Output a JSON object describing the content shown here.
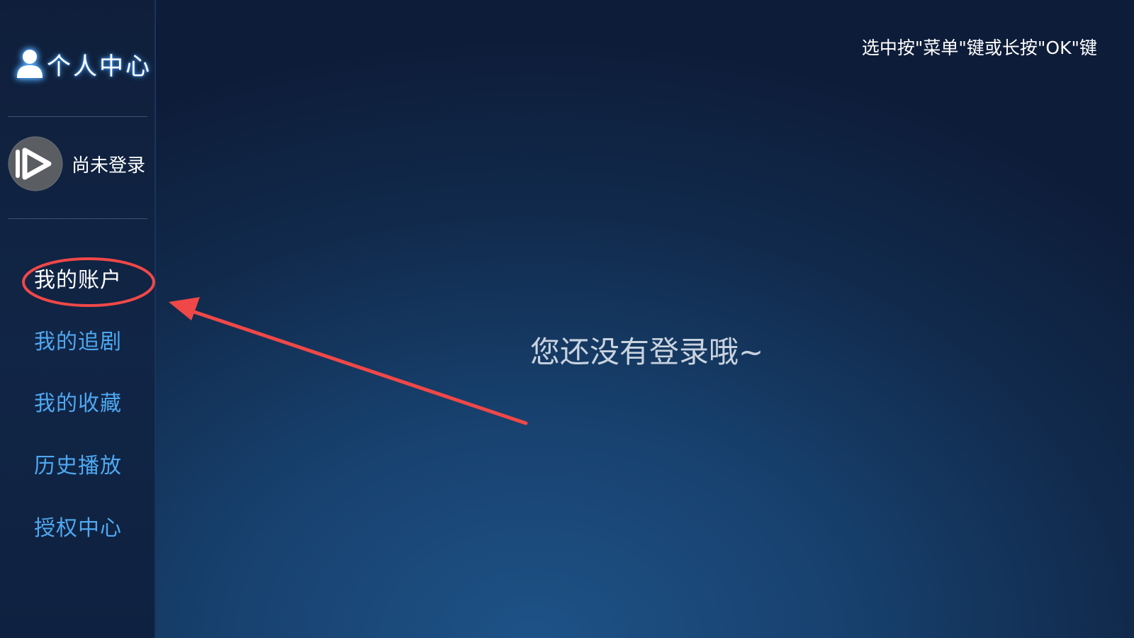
{
  "sidebar": {
    "title": "个人中心",
    "title_icon": "person-icon",
    "user": {
      "avatar_icon": "play-logo-icon",
      "status": "尚未登录"
    },
    "menu": [
      {
        "label": "我的账户",
        "active": true
      },
      {
        "label": "我的追剧",
        "active": false
      },
      {
        "label": "我的收藏",
        "active": false
      },
      {
        "label": "历史播放",
        "active": false
      },
      {
        "label": "授权中心",
        "active": false
      }
    ]
  },
  "header": {
    "hint": "选中按\"菜单\"键或长按\"OK\"键"
  },
  "main": {
    "empty_message": "您还没有登录哦~"
  },
  "annotation": {
    "color": "#f04848",
    "shapes": [
      "ellipse",
      "arrow"
    ]
  },
  "colors": {
    "menu_item": "#4fa8f0",
    "menu_item_active": "#ffffff",
    "glow": "#4aa3ff"
  }
}
